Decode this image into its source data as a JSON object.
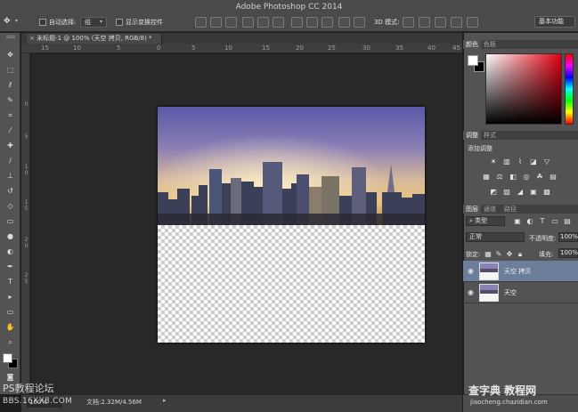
{
  "app": {
    "title": "Adobe Photoshop CC 2014"
  },
  "options_bar": {
    "auto_select_label": "自动选择:",
    "auto_select_value": "组",
    "show_transform_label": "显示变换控件",
    "mode_3d_label": "3D 模式:",
    "workspace": "基本功能"
  },
  "document": {
    "tab_label": "未标题-1 @ 100% (天空 拷贝, RGB/8) *",
    "ruler_h": [
      "15",
      "10",
      "5",
      "0",
      "5",
      "10",
      "15",
      "20",
      "25",
      "30",
      "35",
      "40",
      "45"
    ],
    "ruler_v": [
      "0",
      "5",
      "1",
      "0",
      "1",
      "5",
      "2",
      "0",
      "2",
      "5"
    ]
  },
  "toolbox": {
    "tools": [
      "move-icon",
      "marquee-icon",
      "lasso-icon",
      "quick-select-icon",
      "crop-icon",
      "eyedropper-icon",
      "healing-icon",
      "brush-icon",
      "stamp-icon",
      "history-brush-icon",
      "eraser-icon",
      "gradient-icon",
      "blur-icon",
      "dodge-icon",
      "pen-icon",
      "type-icon",
      "path-select-icon",
      "shape-icon",
      "hand-icon",
      "zoom-icon"
    ]
  },
  "status": {
    "zoom": "100%",
    "doc_info": "文档:2.32M/4.56M"
  },
  "watermark": {
    "left_title": "PS教程论坛",
    "left_url": "BBS.16XX8.COM",
    "right_brand": "查字典 教程网",
    "right_url": "jiaocheng.chazidian.com"
  },
  "panels": {
    "color": {
      "tabs": [
        "颜色",
        "色板"
      ]
    },
    "adjustments": {
      "tabs": [
        "调整",
        "样式"
      ],
      "add_label": "添加调整",
      "row1": [
        "brightness-icon",
        "levels-icon",
        "curves-icon",
        "exposure-icon",
        "vibrance-icon"
      ],
      "row2": [
        "hue-icon",
        "color-balance-icon",
        "bw-icon",
        "photo-filter-icon",
        "channel-mixer-icon",
        "color-lookup-icon"
      ],
      "row3": [
        "invert-icon",
        "posterize-icon",
        "threshold-icon",
        "selective-color-icon",
        "gradient-map-icon"
      ]
    },
    "layers": {
      "tabs": [
        "图层",
        "通道",
        "路径"
      ],
      "filter_kind": "类型",
      "blend_mode": "正常",
      "opacity_label": "不透明度:",
      "opacity": "100%",
      "lock_label": "锁定:",
      "fill_label": "填充:",
      "fill": "100%",
      "items": [
        {
          "name": "天空 拷贝",
          "selected": true
        },
        {
          "name": "天空",
          "selected": false
        }
      ]
    }
  },
  "colors": {
    "options_bg": "#4a4a4a",
    "panel_bg": "#535353",
    "canvas_bg": "#282828",
    "selection": "#6c7e9a"
  }
}
